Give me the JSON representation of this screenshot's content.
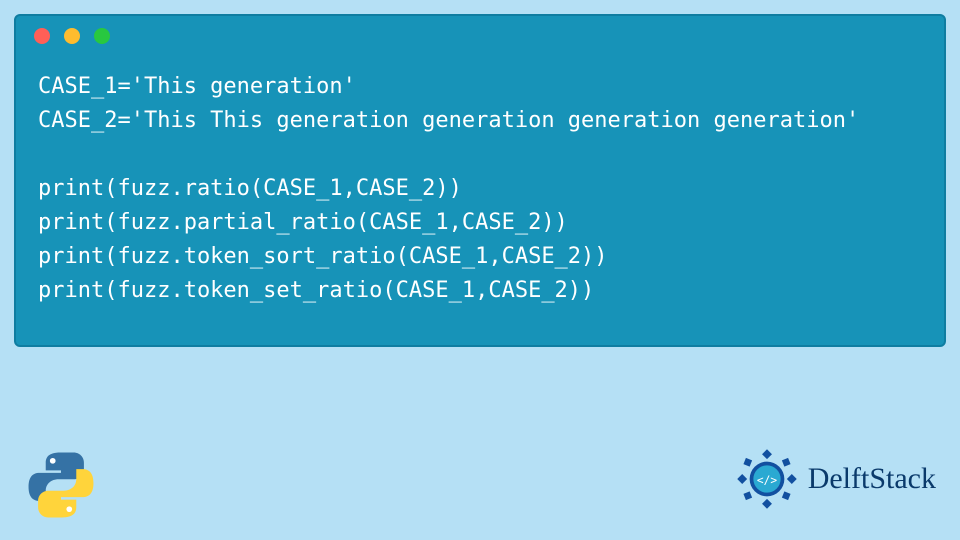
{
  "window": {
    "dots": [
      "red",
      "yellow",
      "green"
    ]
  },
  "code": {
    "lines": [
      "CASE_1='This generation'",
      "CASE_2='This This generation generation generation generation'",
      "",
      "print(fuzz.ratio(CASE_1,CASE_2))",
      "print(fuzz.partial_ratio(CASE_1,CASE_2))",
      "print(fuzz.token_sort_ratio(CASE_1,CASE_2))",
      "print(fuzz.token_set_ratio(CASE_1,CASE_2))"
    ]
  },
  "branding": {
    "site_name": "DelftStack",
    "language_icon": "python"
  }
}
